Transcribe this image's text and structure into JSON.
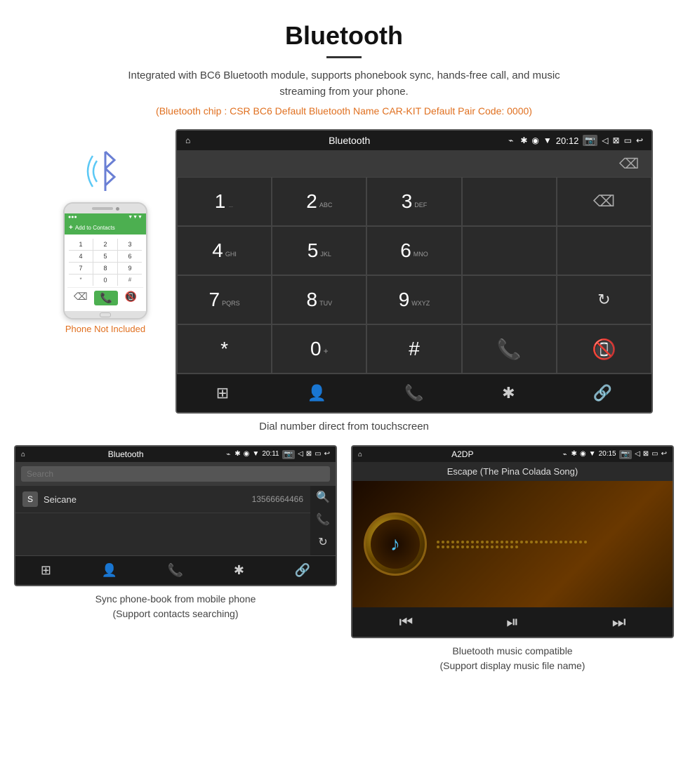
{
  "header": {
    "title": "Bluetooth",
    "subtitle": "Integrated with BC6 Bluetooth module, supports phonebook sync, hands-free call, and music streaming from your phone.",
    "chip_info": "(Bluetooth chip : CSR BC6    Default Bluetooth Name CAR-KIT    Default Pair Code: 0000)"
  },
  "car_screen": {
    "status_bar": {
      "home_icon": "⌂",
      "title": "Bluetooth",
      "usb_icon": "⌁",
      "bt_icon": "✱",
      "location_icon": "◉",
      "signal_icon": "▼",
      "time": "20:12",
      "camera_icon": "⊡",
      "volume_icon": "◁",
      "x_icon": "⊠",
      "rect_icon": "▭",
      "back_icon": "↩"
    },
    "keypad": {
      "rows": [
        [
          "1",
          "2 ABC",
          "3 DEF",
          "",
          "⌫"
        ],
        [
          "4 GHI",
          "5 JKL",
          "6 MNO",
          "",
          ""
        ],
        [
          "7 PQRS",
          "8 TUV",
          "9 WXYZ",
          "",
          "↻"
        ],
        [
          "*",
          "0+",
          "#",
          "📞",
          "📵"
        ]
      ]
    },
    "bottom_toolbar": {
      "items": [
        "⊞",
        "👤",
        "📞",
        "✱",
        "🔗"
      ]
    }
  },
  "caption_dial": "Dial number direct from touchscreen",
  "phonebook_screen": {
    "status": {
      "home": "⌂",
      "title": "Bluetooth",
      "usb": "⌁",
      "bt": "✱",
      "loc": "◉",
      "sig": "▼",
      "time": "20:11",
      "cam": "⊡",
      "vol": "◁",
      "x": "⊠",
      "rect": "▭",
      "back": "↩"
    },
    "search_placeholder": "Search",
    "contacts": [
      {
        "initial": "S",
        "name": "Seicane",
        "number": "13566664466"
      }
    ],
    "side_icons": [
      "🔍",
      "📞",
      "↻"
    ],
    "toolbar": [
      "⊞",
      "👤",
      "📞",
      "✱",
      "🔗"
    ]
  },
  "phonebook_caption": {
    "line1": "Sync phone-book from mobile phone",
    "line2": "(Support contacts searching)"
  },
  "a2dp_screen": {
    "status": {
      "home": "⌂",
      "title": "A2DP",
      "usb": "⌁",
      "bt": "✱",
      "loc": "◉",
      "sig": "▼",
      "time": "20:15",
      "cam": "⊡",
      "vol": "◁",
      "x": "⊠",
      "rect": "▭",
      "back": "↩"
    },
    "song_title": "Escape (The Pina Colada Song)",
    "controls": {
      "prev": "⏮",
      "play_pause": "⏯",
      "next": "⏭"
    }
  },
  "a2dp_caption": {
    "line1": "Bluetooth music compatible",
    "line2": "(Support display music file name)"
  },
  "phone_mockup": {
    "label": "Phone Not Included",
    "add_contacts": "Add to Contacts",
    "number": ""
  }
}
